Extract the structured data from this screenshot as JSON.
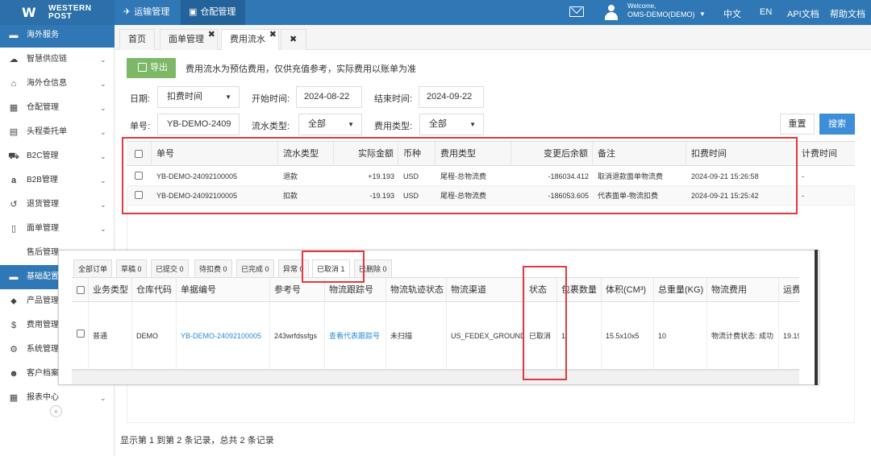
{
  "brand": {
    "line1": "WESTERN",
    "line2": "POST"
  },
  "topnav": {
    "tab1": "运输管理",
    "tab2": "仓配管理",
    "welcome": "Welcome,",
    "user": "OMS-DEMO(DEMO)",
    "lang_zh": "中文",
    "lang_en": "EN",
    "api_doc": "API文档",
    "help_doc": "帮助文档"
  },
  "sidebar": {
    "items": [
      {
        "label": "海外服务",
        "icon": "folder-icon"
      },
      {
        "label": "智慧供应链",
        "icon": "cloud-icon"
      },
      {
        "label": "海外仓信息",
        "icon": "home-icon"
      },
      {
        "label": "仓配管理",
        "icon": "grid-icon"
      },
      {
        "label": "头程委托单",
        "icon": "briefcase-icon"
      },
      {
        "label": "B2C管理",
        "icon": "cart-icon"
      },
      {
        "label": "B2B管理",
        "icon": "amazon-icon"
      },
      {
        "label": "退货管理",
        "icon": "return-icon"
      },
      {
        "label": "面单管理",
        "icon": "document-icon"
      },
      {
        "label": "售后管理",
        "icon": ""
      },
      {
        "label": "基础配置",
        "icon": "folder-icon"
      },
      {
        "label": "产品管理",
        "icon": "tag-icon"
      },
      {
        "label": "费用管理",
        "icon": "dollar-icon"
      },
      {
        "label": "系统管理",
        "icon": "gear-icon"
      },
      {
        "label": "客户档案",
        "icon": "users-icon"
      },
      {
        "label": "报表中心",
        "icon": "table-icon"
      }
    ]
  },
  "pagetabs": {
    "home": "首页",
    "t1": "面单管理",
    "t2": "费用流水"
  },
  "toolbar": {
    "export": "导出",
    "notice": "费用流水为预估费用，仅供充值参考，实际费用以账单为准"
  },
  "filters": {
    "date_label": "日期:",
    "date_type": "扣费时间",
    "start_label": "开始时间:",
    "start_value": "2024-08-22",
    "end_label": "结束时间:",
    "end_value": "2024-09-22",
    "order_label": "单号:",
    "order_value": "YB-DEMO-2409",
    "flow_label": "流水类型:",
    "flow_value": "全部",
    "fee_label": "费用类型:",
    "fee_value": "全部",
    "reset": "重置",
    "search": "搜索"
  },
  "flow_table": {
    "headers": [
      "单号",
      "流水类型",
      "实际金额",
      "币种",
      "费用类型",
      "变更后余额",
      "备注",
      "扣费时间",
      "计费时间"
    ],
    "rows": [
      [
        "YB-DEMO-24092100005",
        "退款",
        "+19.193",
        "USD",
        "尾程-总物流费",
        "-186034.412",
        "取消退款面单物流费",
        "2024-09-21 15:26:58",
        "-"
      ],
      [
        "YB-DEMO-24092100005",
        "扣款",
        "-19.193",
        "USD",
        "尾程-总物流费",
        "-186053.605",
        "代表面单-物流扣费",
        "2024-09-21 15:25:42",
        "-"
      ]
    ]
  },
  "overlay": {
    "tabs": [
      "全部订单",
      "草稿 0",
      "已提交 0",
      "待扣费 0",
      "已完成 0",
      "异常 0",
      "已取消 1",
      "已删除 0"
    ],
    "headers": [
      "业务类型",
      "仓库代码",
      "单据编号",
      "参考号",
      "物流跟踪号",
      "物流轨迹状态",
      "物流渠道",
      "状态",
      "包裹数量",
      "体积(CM³)",
      "总重量(KG)",
      "物流费用",
      "运费"
    ],
    "row": [
      "普通",
      "DEMO",
      "YB-DEMO-24092100005",
      "243wrfdssfgs",
      "查看代表跟踪号",
      "未扫描",
      "US_FEDEX_GROUND",
      "已取消",
      "1",
      "15.5x10x5",
      "10",
      "物流计费状态: 成功",
      "19.19"
    ]
  },
  "footer": {
    "summary": "显示第 1 到第 2 条记录，总共 2 条记录"
  },
  "colors": {
    "topbar": "#2f77b5",
    "active": "#2f77b5",
    "export": "#7cb867",
    "search": "#3d8ed8",
    "highlight": "#e0393e",
    "link": "#2a8bd6"
  }
}
